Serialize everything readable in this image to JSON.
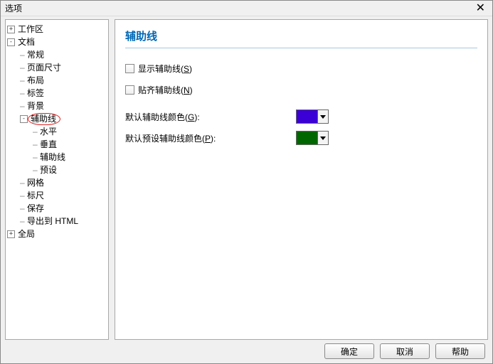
{
  "window": {
    "title": "选项"
  },
  "tree": {
    "workspace": "工作区",
    "document": "文档",
    "doc_children": {
      "general": "常规",
      "pagesize": "页面尺寸",
      "layout": "布局",
      "labels": "标签",
      "background": "背景",
      "guides": "辅助线",
      "guides_children": {
        "horizontal": "水平",
        "vertical": "垂直",
        "guides": "辅助线",
        "preset": "预设"
      },
      "grid": "网格",
      "ruler": "标尺",
      "save": "保存",
      "export_html": "导出到 HTML"
    },
    "global": "全局"
  },
  "panel": {
    "title": "辅助线",
    "show_label_pre": "显示辅助线(",
    "show_label_key": "S",
    "show_label_post": ")",
    "snap_label_pre": "贴齐辅助线(",
    "snap_label_key": "N",
    "snap_label_post": ")",
    "default_color_pre": "默认辅助线颜色(",
    "default_color_key": "G",
    "default_color_post": "):",
    "preset_color_pre": "默认预设辅助线颜色(",
    "preset_color_key": "P",
    "preset_color_post": "):",
    "default_color": "#3b00d6",
    "preset_color": "#006600"
  },
  "buttons": {
    "ok": "确定",
    "cancel": "取消",
    "help": "帮助"
  }
}
